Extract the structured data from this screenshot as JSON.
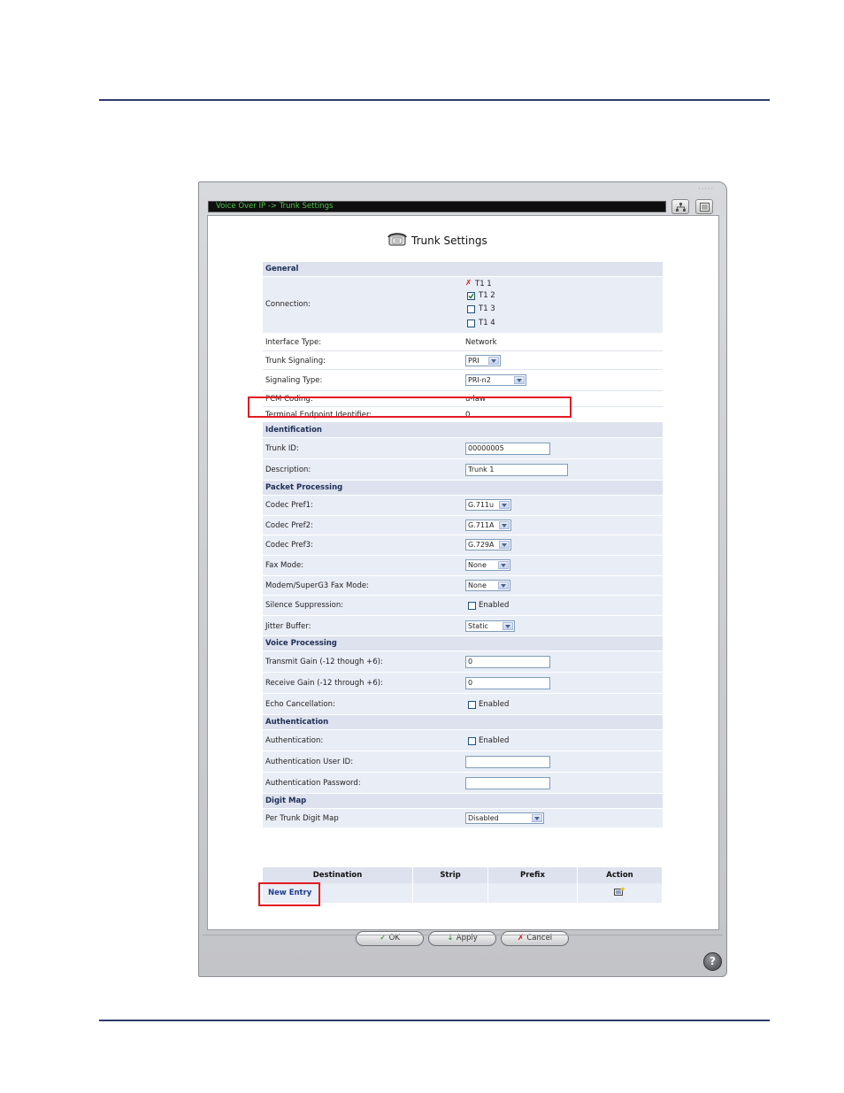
{
  "breadcrumb": "Voice Over IP -> Trunk Settings",
  "page_title": "Trunk Settings",
  "sections": {
    "general": "General",
    "identification": "Identification",
    "packet_processing": "Packet Processing",
    "voice_processing": "Voice Processing",
    "authentication": "Authentication",
    "digit_map": "Digit Map"
  },
  "connection": {
    "label": "Connection:",
    "items": [
      {
        "name": "T1 1",
        "state": "unavailable"
      },
      {
        "name": "T1 2",
        "state": "checked"
      },
      {
        "name": "T1 3",
        "state": "unchecked"
      },
      {
        "name": "T1 4",
        "state": "unchecked"
      }
    ]
  },
  "fields": {
    "interface_type": {
      "label": "Interface Type:",
      "value": "Network"
    },
    "trunk_signaling": {
      "label": "Trunk Signaling:",
      "value": "PRI"
    },
    "signaling_type": {
      "label": "Signaling Type:",
      "value": "PRI-n2"
    },
    "pcm_coding": {
      "label": "PCM Coding:",
      "value": "u-law"
    },
    "tei": {
      "label": "Terminal Endpoint Identifier:",
      "value": "0"
    },
    "trunk_id": {
      "label": "Trunk ID:",
      "value": "00000005"
    },
    "description": {
      "label": "Description:",
      "value": "Trunk 1"
    },
    "codec1": {
      "label": "Codec Pref1:",
      "value": "G.711u"
    },
    "codec2": {
      "label": "Codec Pref2:",
      "value": "G.711A"
    },
    "codec3": {
      "label": "Codec Pref3:",
      "value": "G.729A"
    },
    "fax_mode": {
      "label": "Fax Mode:",
      "value": "None"
    },
    "modem_fax": {
      "label": "Modem/SuperG3 Fax Mode:",
      "value": "None"
    },
    "silence": {
      "label": "Silence Suppression:",
      "value": "Enabled"
    },
    "jitter": {
      "label": "Jitter Buffer:",
      "value": "Static"
    },
    "tx_gain": {
      "label": "Transmit Gain (-12 though +6):",
      "value": "0"
    },
    "rx_gain": {
      "label": "Receive Gain (-12 through +6):",
      "value": "0"
    },
    "echo": {
      "label": "Echo Cancellation:",
      "value": "Enabled"
    },
    "auth": {
      "label": "Authentication:",
      "value": "Enabled"
    },
    "auth_user": {
      "label": "Authentication User ID:",
      "value": ""
    },
    "auth_pass": {
      "label": "Authentication Password:",
      "value": ""
    },
    "digit_map": {
      "label": "Per Trunk Digit Map",
      "value": "Disabled"
    }
  },
  "digit_table": {
    "headers": [
      "Destination",
      "Strip",
      "Prefix",
      "Action"
    ],
    "new_entry": "New Entry"
  },
  "buttons": {
    "ok": "OK",
    "apply": "Apply",
    "cancel": "Cancel"
  },
  "colors": {
    "highlight": "#e31b23",
    "section_bg": "#dde2ee",
    "row_bg": "#e9edf6"
  }
}
